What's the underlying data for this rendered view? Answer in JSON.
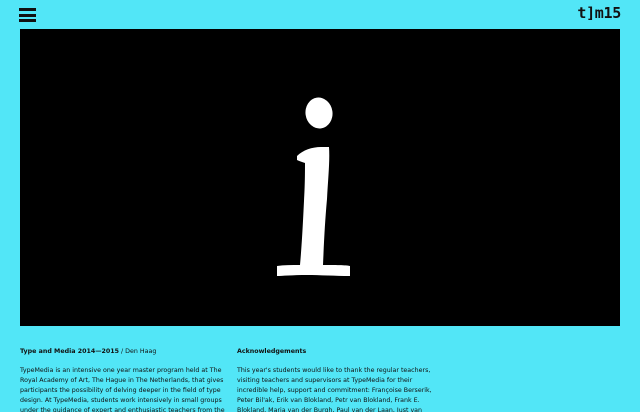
{
  "header": {
    "menu_icon": "hamburger-menu-icon",
    "logo_text": "t]m15"
  },
  "hero": {
    "glyph": "i",
    "background": "#000000",
    "glyph_color": "#ffffff"
  },
  "columns": [
    {
      "title": "Type and Media 2014—2015",
      "title_suffix": " / Den Haag",
      "body": "TypeMedia is an intensive one year master program held at The Royal Academy of Art, The Hague in The Netherlands, that gives participants the possibility of delving deeper in the field of type design. At TypeMedia, students work intensively in small groups under the guidance of expert and enthusiastic teachers from the permanent"
    },
    {
      "title": "Acknowledgements",
      "body": "This year's students would like to thank the regular teachers, visiting teachers and supervisors at TypeMedia for their incredible help, support and commitment: Françoise Berserik, Peter Bil'ak, Erik van Blokland, Petr van Blokland, Frank E. Blokland, Marja van der Burgh, Paul van der Laan, Just van Rossum, Fred Smeijers, Jan Willem Stas,"
    }
  ],
  "colors": {
    "background": "#52e6f7",
    "text": "#111111"
  }
}
